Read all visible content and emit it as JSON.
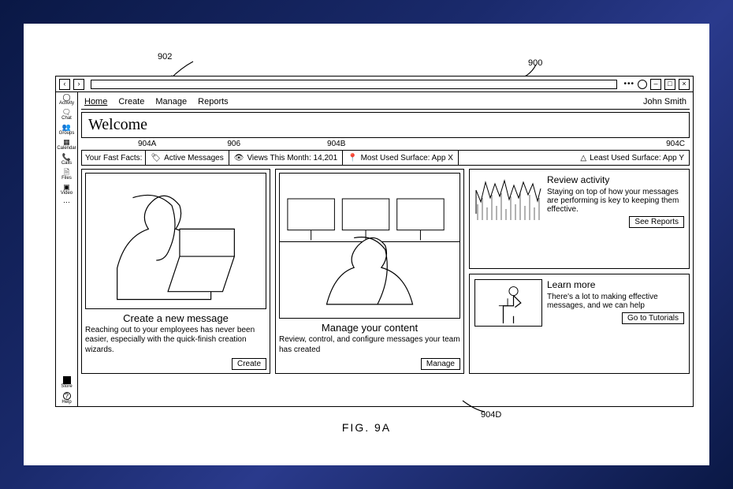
{
  "figure": {
    "label": "FIG. 9A"
  },
  "callouts": {
    "topLeft": "902",
    "appRef": "900",
    "a": "904A",
    "b": "904B",
    "c": "904C",
    "d": "904D",
    "views": "906"
  },
  "rail": {
    "items": [
      {
        "icon": "◯",
        "label": "Activity"
      },
      {
        "icon": "🗨",
        "label": "Chat"
      },
      {
        "icon": "👥",
        "label": "Groups"
      },
      {
        "icon": "▦",
        "label": "Calendar"
      },
      {
        "icon": "📞",
        "label": "Calls"
      },
      {
        "icon": "🗎",
        "label": "Files"
      },
      {
        "icon": "▣",
        "label": "Video"
      },
      {
        "icon": "⋯",
        "label": ""
      }
    ],
    "store": {
      "label": "Store"
    },
    "help": {
      "icon": "?",
      "label": "Help"
    }
  },
  "menu": {
    "items": [
      "Home",
      "Create",
      "Manage",
      "Reports"
    ],
    "user": "John Smith"
  },
  "welcome": {
    "title": "Welcome"
  },
  "facts": {
    "label": "Your Fast Facts:",
    "active": "Active Messages",
    "views": "Views This Month: 14,201",
    "most": "Most Used Surface: App X",
    "least": "Least Used Surface: App Y"
  },
  "cards": {
    "create": {
      "title": "Create a new message",
      "desc": "Reaching out to your employees has never been easier, especially with the quick-finish creation wizards.",
      "btn": "Create"
    },
    "manage": {
      "title": "Manage your content",
      "desc": "Review, control, and configure messages your team has created",
      "btn": "Manage"
    },
    "review": {
      "title": "Review activity",
      "desc": "Staying on top of how your messages are performing is key to keeping them effective.",
      "btn": "See Reports"
    },
    "learn": {
      "title": "Learn more",
      "desc": "There's a lot to making effective messages, and we can help",
      "btn": "Go to Tutorials"
    }
  }
}
